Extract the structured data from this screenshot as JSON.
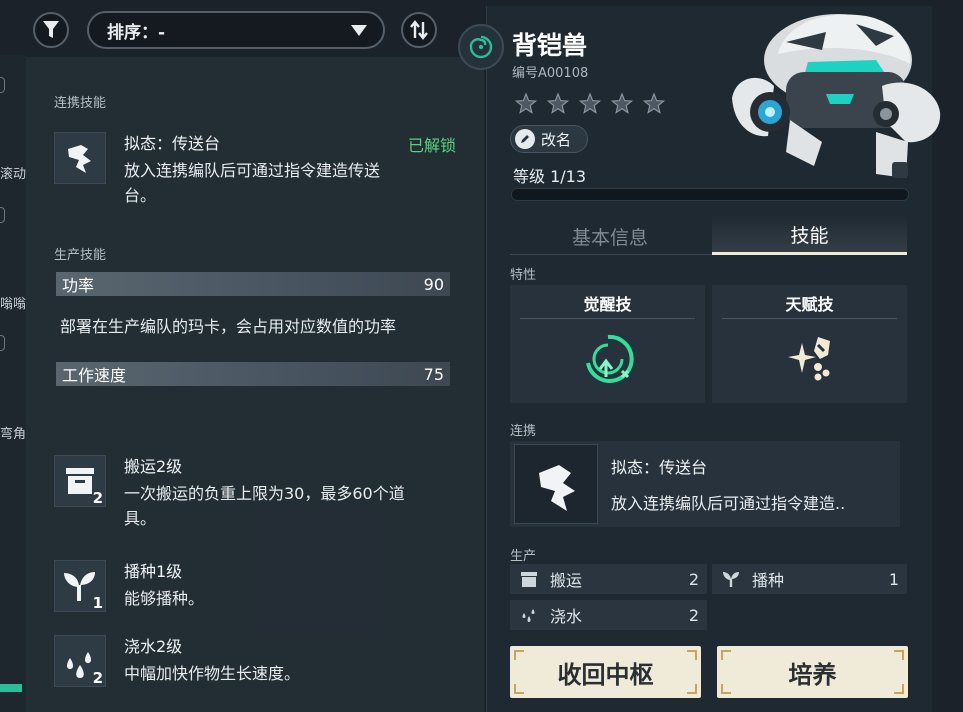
{
  "toolbar": {
    "filter_icon": "filter-funnel-icon",
    "sort_label": "排序：-",
    "order_icon": "sort-order-icon"
  },
  "background_list": {
    "fragments": [
      "滚动",
      "嗡嗡",
      "弯角"
    ]
  },
  "skill_popover": {
    "link_section_title": "连携技能",
    "link_skill": {
      "name": "拟态：传送台",
      "status": "已解锁",
      "desc_line1": "放入连携编队后可通过指令建造传送",
      "desc_line2": "台。"
    },
    "production_section_title": "生产技能",
    "power": {
      "label": "功率",
      "value": "90"
    },
    "power_note": "部署在生产编队的玛卡，会占用对应数值的功率",
    "work_speed": {
      "label": "工作速度",
      "value": "75"
    },
    "production_skills": [
      {
        "icon": "storage-box-icon",
        "level": "2",
        "name": "搬运2级",
        "desc_line1": "一次搬运的负重上限为30，最多60个道",
        "desc_line2": "具。"
      },
      {
        "icon": "sprout-icon",
        "level": "1",
        "name": "播种1级",
        "desc_line1": "能够播种。",
        "desc_line2": ""
      },
      {
        "icon": "water-drops-icon",
        "level": "2",
        "name": "浇水2级",
        "desc_line1": "中幅加快作物生长速度。",
        "desc_line2": ""
      }
    ]
  },
  "character": {
    "name": "背铠兽",
    "id": "编号A00108",
    "star_count": 5,
    "stars_filled": 0,
    "rename_label": "改名",
    "level_label": "等级 1/13",
    "xp_fraction": 0.0,
    "tabs": [
      {
        "label": "基本信息",
        "active": false
      },
      {
        "label": "技能",
        "active": true
      }
    ],
    "traits_label": "特性",
    "traits": [
      {
        "title": "觉醒技",
        "icon": "awaken-swirl-icon"
      },
      {
        "title": "天赋技",
        "icon": "talent-sparkle-icon"
      }
    ],
    "link_label": "连携",
    "link_card": {
      "name": "拟态：传送台",
      "desc": "放入连携编队后可通过指令建造.."
    },
    "production_label": "生产",
    "production": [
      {
        "icon": "storage-box-icon",
        "label": "搬运",
        "value": "2"
      },
      {
        "icon": "sprout-icon",
        "label": "播种",
        "value": "1"
      },
      {
        "icon": "water-drops-icon",
        "label": "浇水",
        "value": "2"
      }
    ],
    "buttons": {
      "recall": "收回中枢",
      "train": "培养"
    }
  },
  "colors": {
    "unlocked_green": "#56d37b",
    "accent_teal": "#2bbd9a",
    "button_cream": "#f0ead8"
  }
}
